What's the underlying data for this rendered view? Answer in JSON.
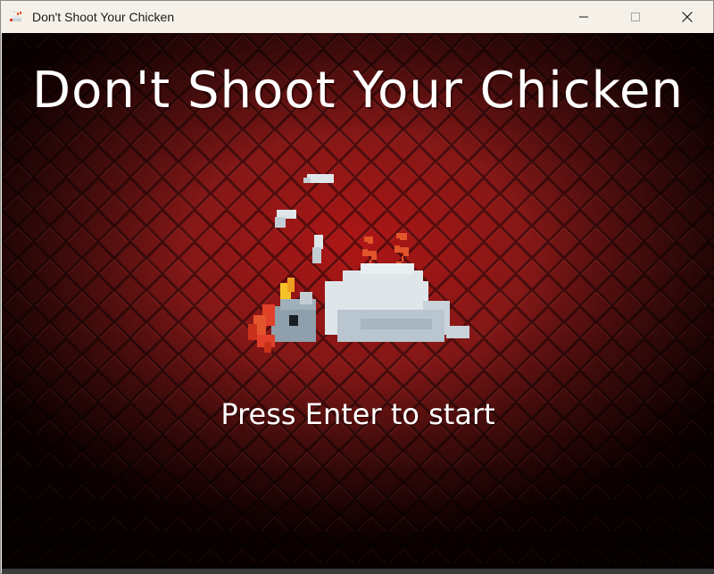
{
  "window": {
    "title": "Don't Shoot Your Chicken",
    "app_icon": "chicken-app-icon",
    "controls": {
      "minimize_icon": "minimize-icon",
      "maximize_icon": "maximize-icon",
      "close_icon": "close-icon"
    }
  },
  "game": {
    "title": "Don't Shoot Your Chicken",
    "prompt": "Press Enter to start",
    "sprite": "dead-chicken-icon",
    "colors": {
      "background": "#8b0000",
      "text": "#ffffff"
    }
  }
}
